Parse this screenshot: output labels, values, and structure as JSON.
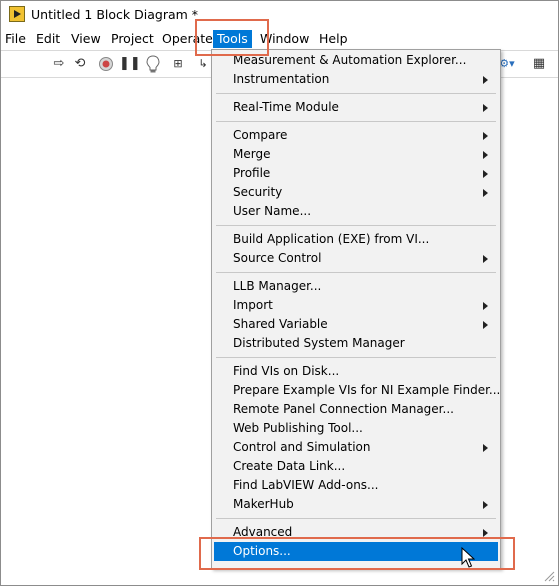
{
  "window": {
    "title": "Untitled 1 Block Diagram *"
  },
  "menubar": {
    "items": [
      {
        "label": "File"
      },
      {
        "label": "Edit"
      },
      {
        "label": "View"
      },
      {
        "label": "Project"
      },
      {
        "label": "Operate"
      },
      {
        "label": "Tools"
      },
      {
        "label": "Window"
      },
      {
        "label": "Help"
      }
    ],
    "active": "Tools"
  },
  "toolbar": {
    "icons": [
      "run-arrow-icon",
      "run-continuously-icon",
      "abort-icon",
      "pause-icon",
      "highlight-execution-icon",
      "retain-wire-values-icon",
      "step-into-icon",
      "context-help-icon"
    ]
  },
  "tools_menu": {
    "groups": [
      [
        {
          "label": "Measurement & Automation Explorer...",
          "submenu": false
        },
        {
          "label": "Instrumentation",
          "submenu": true
        }
      ],
      [
        {
          "label": "Real-Time Module",
          "submenu": true
        }
      ],
      [
        {
          "label": "Compare",
          "submenu": true
        },
        {
          "label": "Merge",
          "submenu": true
        },
        {
          "label": "Profile",
          "submenu": true
        },
        {
          "label": "Security",
          "submenu": true
        },
        {
          "label": "User Name...",
          "submenu": false
        }
      ],
      [
        {
          "label": "Build Application (EXE) from VI...",
          "submenu": false
        },
        {
          "label": "Source Control",
          "submenu": true
        }
      ],
      [
        {
          "label": "LLB Manager...",
          "submenu": false
        },
        {
          "label": "Import",
          "submenu": true
        },
        {
          "label": "Shared Variable",
          "submenu": true
        },
        {
          "label": "Distributed System Manager",
          "submenu": false
        }
      ],
      [
        {
          "label": "Find VIs on Disk...",
          "submenu": false
        },
        {
          "label": "Prepare Example VIs for NI Example Finder...",
          "submenu": false
        },
        {
          "label": "Remote Panel Connection Manager...",
          "submenu": false
        },
        {
          "label": "Web Publishing Tool...",
          "submenu": false
        },
        {
          "label": "Control and Simulation",
          "submenu": true
        },
        {
          "label": "Create Data Link...",
          "submenu": false
        },
        {
          "label": "Find LabVIEW Add-ons...",
          "submenu": false
        },
        {
          "label": "MakerHub",
          "submenu": true
        }
      ],
      [
        {
          "label": "Advanced",
          "submenu": true
        },
        {
          "label": "Options...",
          "submenu": false,
          "highlighted": true
        }
      ]
    ]
  },
  "colors": {
    "highlight": "#0078d7",
    "callout": "#e06a4c",
    "menu_bg": "#f2f2f2"
  }
}
